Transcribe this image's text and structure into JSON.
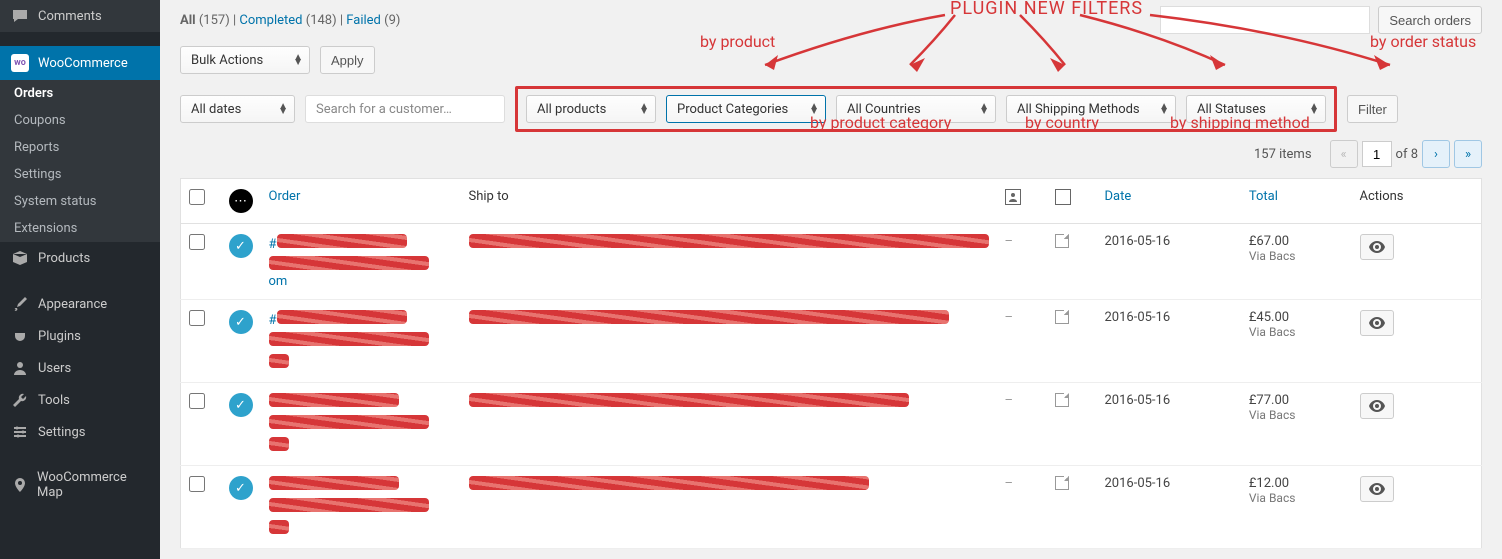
{
  "sidebar": {
    "top_items": [
      {
        "name": "comments",
        "label": "Comments",
        "icon": "comment"
      }
    ],
    "woocommerce": {
      "label": "WooCommerce",
      "sub": [
        {
          "name": "orders",
          "label": "Orders",
          "current": true
        },
        {
          "name": "coupons",
          "label": "Coupons"
        },
        {
          "name": "reports",
          "label": "Reports"
        },
        {
          "name": "settings",
          "label": "Settings"
        },
        {
          "name": "system-status",
          "label": "System status"
        },
        {
          "name": "extensions",
          "label": "Extensions"
        }
      ]
    },
    "items": [
      {
        "name": "products",
        "label": "Products",
        "icon": "box"
      },
      {
        "name": "appearance",
        "label": "Appearance",
        "icon": "brush"
      },
      {
        "name": "plugins",
        "label": "Plugins",
        "icon": "plug"
      },
      {
        "name": "users",
        "label": "Users",
        "icon": "user"
      },
      {
        "name": "tools",
        "label": "Tools",
        "icon": "wrench"
      },
      {
        "name": "settings",
        "label": "Settings",
        "icon": "sliders"
      },
      {
        "name": "woocommerce-map",
        "label": "WooCommerce Map",
        "icon": "map"
      }
    ]
  },
  "subsubsub": {
    "all_label": "All",
    "all_count": "(157)",
    "sep": " | ",
    "completed_label": "Completed",
    "completed_count": "(148)",
    "failed_label": "Failed",
    "failed_count": "(9)"
  },
  "search": {
    "button": "Search orders",
    "value": ""
  },
  "bulk": {
    "select_label": "Bulk Actions",
    "apply": "Apply"
  },
  "filters": {
    "dates": "All dates",
    "customer_placeholder": "Search for a customer…",
    "products": "All products",
    "product_categories": "Product Categories",
    "countries": "All Countries",
    "shipping": "All Shipping Methods",
    "statuses": "All Statuses",
    "filter_btn": "Filter"
  },
  "annotations": {
    "title": "PLUGIN NEW FILTERS",
    "by_product": "by product",
    "by_product_category": "by product category",
    "by_country": "by country",
    "by_shipping": "by shipping method",
    "by_status": "by order status"
  },
  "pagination": {
    "items_label": "157 items",
    "current": "1",
    "of_label": "of 8"
  },
  "table": {
    "headers": {
      "order": "Order",
      "ship_to": "Ship to",
      "date": "Date",
      "total": "Total",
      "actions": "Actions"
    },
    "rows": [
      {
        "order_prefix": "#",
        "order_suffix": "om",
        "ship_dash": "–",
        "date": "2016-05-16",
        "total": "£67.00",
        "via": "Via Bacs"
      },
      {
        "order_prefix": "#",
        "order_suffix": "",
        "ship_dash": "–",
        "date": "2016-05-16",
        "total": "£45.00",
        "via": "Via Bacs"
      },
      {
        "order_prefix": "",
        "order_suffix": "",
        "ship_dash": "–",
        "date": "2016-05-16",
        "total": "£77.00",
        "via": "Via Bacs"
      },
      {
        "order_prefix": "",
        "order_suffix": "",
        "ship_dash": "–",
        "date": "2016-05-16",
        "total": "£12.00",
        "via": "Via Bacs"
      }
    ]
  },
  "colors": {
    "annotation": "#d63638",
    "link": "#0073aa"
  }
}
